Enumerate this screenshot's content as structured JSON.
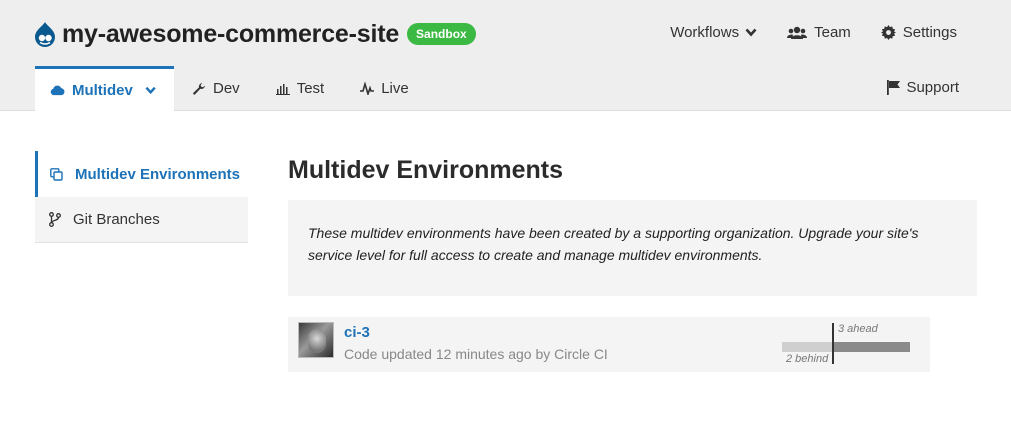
{
  "site": {
    "name": "my-awesome-commerce-site",
    "badge": "Sandbox"
  },
  "top_nav": {
    "workflows": "Workflows",
    "team": "Team",
    "settings": "Settings"
  },
  "env_tabs": [
    {
      "label": "Multidev",
      "icon": "cloud-icon",
      "active": true
    },
    {
      "label": "Dev",
      "icon": "wrench-icon"
    },
    {
      "label": "Test",
      "icon": "bar-chart-icon"
    },
    {
      "label": "Live",
      "icon": "pulse-icon"
    }
  ],
  "support": "Support",
  "sidebar": {
    "items": [
      {
        "label": "Multidev Environments",
        "icon": "copy-icon",
        "active": true
      },
      {
        "label": "Git Branches",
        "icon": "git-branch-icon"
      }
    ]
  },
  "main": {
    "title": "Multidev Environments",
    "notice": "These multidev environments have been created by a supporting organization. Upgrade your site's service level for full access to create and manage multidev environments."
  },
  "environments": [
    {
      "name": "ci-3",
      "status": "Code updated 12 minutes ago by Circle CI",
      "ahead_label": "3 ahead",
      "behind_label": "2 behind",
      "ahead": 3,
      "behind": 2
    }
  ],
  "colors": {
    "accent": "#1d72b8",
    "badge": "#3cb943",
    "header_bg": "#eeeeee"
  }
}
